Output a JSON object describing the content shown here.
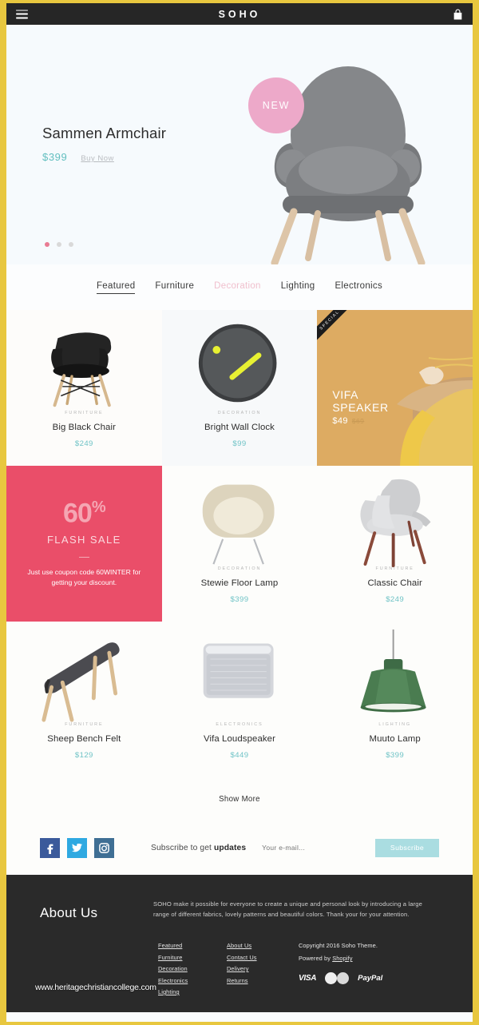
{
  "topbar": {
    "brand": "SOHO",
    "menu_icon": "hamburger-icon",
    "bag_icon": "bag-icon"
  },
  "hero": {
    "title": "Sammen Armchair",
    "price": "$399",
    "buy_label": "Buy Now",
    "badge": "NEW",
    "dots": 3,
    "active_dot": 0
  },
  "tabs": [
    {
      "label": "Featured",
      "state": "active"
    },
    {
      "label": "Furniture",
      "state": "normal"
    },
    {
      "label": "Decoration",
      "state": "hover"
    },
    {
      "label": "Lighting",
      "state": "normal"
    },
    {
      "label": "Electronics",
      "state": "normal"
    }
  ],
  "products": [
    {
      "category": "FURNITURE",
      "name": "Big Black Chair",
      "price": "$249"
    },
    {
      "category": "DECORATION",
      "name": "Bright Wall Clock",
      "price": "$99"
    },
    {
      "category": "DECORATION",
      "name": "Stewie Floor Lamp",
      "price": "$399"
    },
    {
      "category": "FURNITURE",
      "name": "Classic Chair",
      "price": "$249"
    },
    {
      "category": "FURNITURE",
      "name": "Sheep Bench Felt",
      "price": "$129"
    },
    {
      "category": "ELECTRONICS",
      "name": "Vifa Loudspeaker",
      "price": "$449"
    },
    {
      "category": "LIGHTING",
      "name": "Muuto Lamp",
      "price": "$399"
    }
  ],
  "promo_vifa": {
    "ribbon": "SPECIAL",
    "line1": "VIFA",
    "line2": "SPEAKER",
    "price": "$49",
    "old_price": "$69"
  },
  "promo_flash": {
    "percent": "60",
    "percent_symbol": "%",
    "heading": "FLASH SALE",
    "text": "Just use coupon code 60WINTER for getting your discount."
  },
  "show_more": "Show More",
  "subscribe": {
    "social": [
      {
        "name": "facebook-icon",
        "glyph": "f"
      },
      {
        "name": "twitter-icon",
        "glyph": "✉"
      },
      {
        "name": "instagram-icon",
        "glyph": "▣"
      }
    ],
    "label_plain": "Subscribe to get ",
    "label_bold": "updates",
    "email_placeholder": "Your e-mail...",
    "button": "Subscribe"
  },
  "footer": {
    "heading": "About Us",
    "description": "SOHO make it possible for everyone to create a unique and personal look by introducing a large range of different fabrics, lovely patterns and beautiful colors. Thank your for your attention.",
    "col1": [
      "Featured",
      "Furniture",
      "Decoration",
      "Electronics",
      "Lighting"
    ],
    "col2": [
      "About Us",
      "Contact Us",
      "Delivery",
      "Returns"
    ],
    "copyright": "Copyright 2016 Soho Theme.",
    "powered_prefix": "Powered by ",
    "powered_link": "Shopify",
    "payments": [
      "VISA",
      "mastercard-logo",
      "PayPal"
    ]
  },
  "watermark": "www.heritagechristiancollege.com",
  "colors": {
    "page_border": "#e8c73f",
    "accent_teal": "#6fc3c6",
    "accent_pink": "#eda9c9",
    "flash_bg": "#ea4e69",
    "promo_bg": "#ddab62",
    "dark": "#262626"
  }
}
